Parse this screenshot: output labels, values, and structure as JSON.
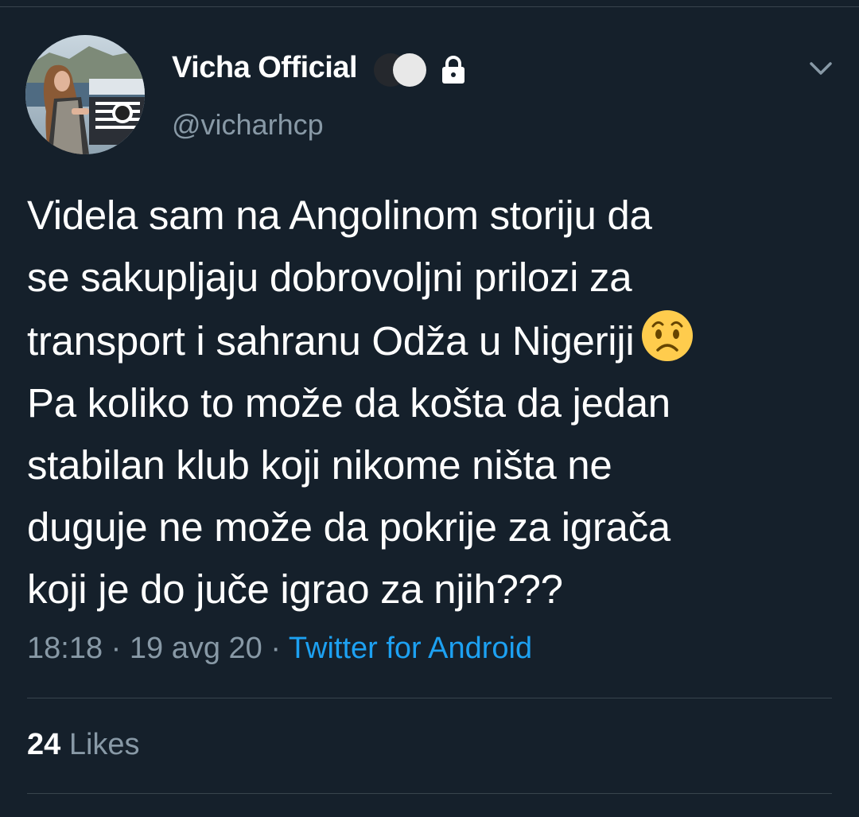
{
  "author": {
    "display_name": "Vicha Official",
    "handle": "@vicharhcp",
    "avatar_icon": "profile-photo",
    "badge_icons": [
      "dark-circle-emoji",
      "white-circle-emoji"
    ],
    "protected_icon": "lock-icon"
  },
  "tweet": {
    "lines": [
      "Videla sam na Angolinom storiju da",
      "se sakupljaju dobrovoljni prilozi za",
      "transport i sahranu Odža u Nigeriji",
      "Pa koliko to može da košta da jedan",
      "stabilan klub koji nikome ništa ne",
      "duguje ne može da pokrije za igrača",
      "koji je do juče igrao za njih???"
    ],
    "emoji_icon": "worried-face-emoji",
    "time": "18:18",
    "separator": " · ",
    "date": "19 avg 20",
    "source": "Twitter for Android"
  },
  "stats": {
    "likes_count": "24",
    "likes_label": " Likes"
  },
  "menu": {
    "chevron_icon": "chevron-down-icon"
  },
  "colors": {
    "background": "#15202b",
    "divider": "#38444d",
    "secondary_text": "#8899a6",
    "link": "#1da1f2",
    "primary_text": "#ffffff"
  }
}
